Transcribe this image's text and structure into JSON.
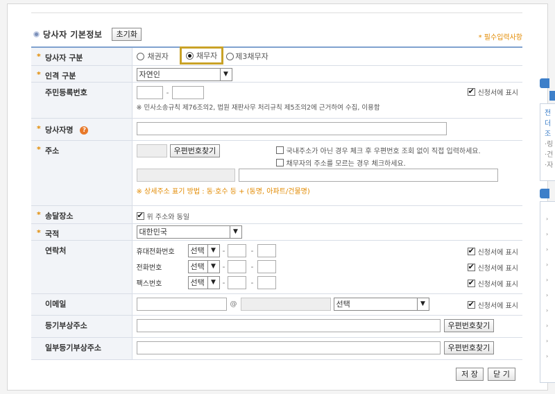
{
  "section": {
    "title": "당사자 기본정보",
    "reset_label": "초기화",
    "required_note": "* 필수입력사항"
  },
  "party_type": {
    "label": "당사자 구분",
    "options": [
      "채권자",
      "채무자",
      "제3채무자"
    ],
    "selected": "채무자"
  },
  "person_type": {
    "label": "인격 구분",
    "selected": "자연인"
  },
  "rrn": {
    "label": "주민등록번호",
    "dash": "-",
    "show_label": "신청서에 표시",
    "note": "※ 민사소송규칙 제76조의2, 법원 재판사무 처리규칙 제5조의2에 근거하여 수집, 이용함"
  },
  "name": {
    "label": "당사자명",
    "help_icon": "question-icon"
  },
  "address": {
    "label": "주소",
    "zip_button": "우편번호찾기",
    "check1": "국내주소가 아닌 경우 체크 후 우편번호 조회 없이 직접 입력하세요.",
    "check2": "채무자의 주소를 모르는 경우 체크하세요.",
    "hint": "※ 상세주소 표기 방법 : 동·호수 등 + (동명, 아파트/건물명)"
  },
  "delivery": {
    "label": "송달장소",
    "same_label": "위 주소와 동일"
  },
  "nationality": {
    "label": "국적",
    "selected": "대한민국"
  },
  "contact": {
    "label": "연락처",
    "rows": [
      {
        "label": "휴대전화번호",
        "select": "선택"
      },
      {
        "label": "전화번호",
        "select": "선택"
      },
      {
        "label": "팩스번호",
        "select": "선택"
      }
    ],
    "dash": "-",
    "show_label": "신청서에 표시"
  },
  "email": {
    "label": "이메일",
    "at": "@",
    "select": "선택",
    "show_label": "신청서에 표시"
  },
  "reg_addr": {
    "label": "등기부상주소",
    "zip_button": "우편번호찾기"
  },
  "partial_reg_addr": {
    "label": "일부등기부상주소",
    "zip_button": "우편번호찾기"
  },
  "actions": {
    "save": "저 장",
    "close": "닫 기"
  },
  "colors": {
    "accent": "#e28a00",
    "header_border": "#7fa1cf",
    "highlight": "#c9a227",
    "side_tab": "#3d7fc9"
  },
  "side_text": [
    "전",
    "더",
    "조",
    "·링",
    "·건",
    "·자"
  ]
}
